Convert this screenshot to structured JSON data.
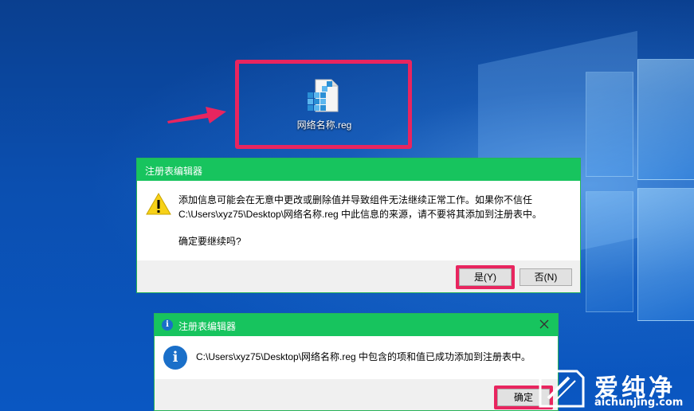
{
  "desktop": {
    "file_icon_label": "网络名称.reg",
    "file_icon": "registry-file-icon"
  },
  "warning_dialog": {
    "title": "注册表编辑器",
    "icon": "warning-icon",
    "message_line1": "添加信息可能会在无意中更改或删除值并导致组件无法继续正常工作。如果你不信任",
    "message_line2": "C:\\Users\\xyz75\\Desktop\\网络名称.reg 中此信息的来源，请不要将其添加到注册表中。",
    "question": "确定要继续吗?",
    "yes_label": "是(Y)",
    "no_label": "否(N)"
  },
  "success_dialog": {
    "title": "注册表编辑器",
    "icon": "info-icon",
    "message": "C:\\Users\\xyz75\\Desktop\\网络名称.reg 中包含的项和值已成功添加到注册表中。",
    "ok_label": "确定"
  },
  "watermark": {
    "brand": "爱纯净",
    "url": "aichunjing.com"
  },
  "colors": {
    "highlight": "#e8255f",
    "titlebar": "#17c45e",
    "desktop_blue": "#0b4fb0"
  }
}
